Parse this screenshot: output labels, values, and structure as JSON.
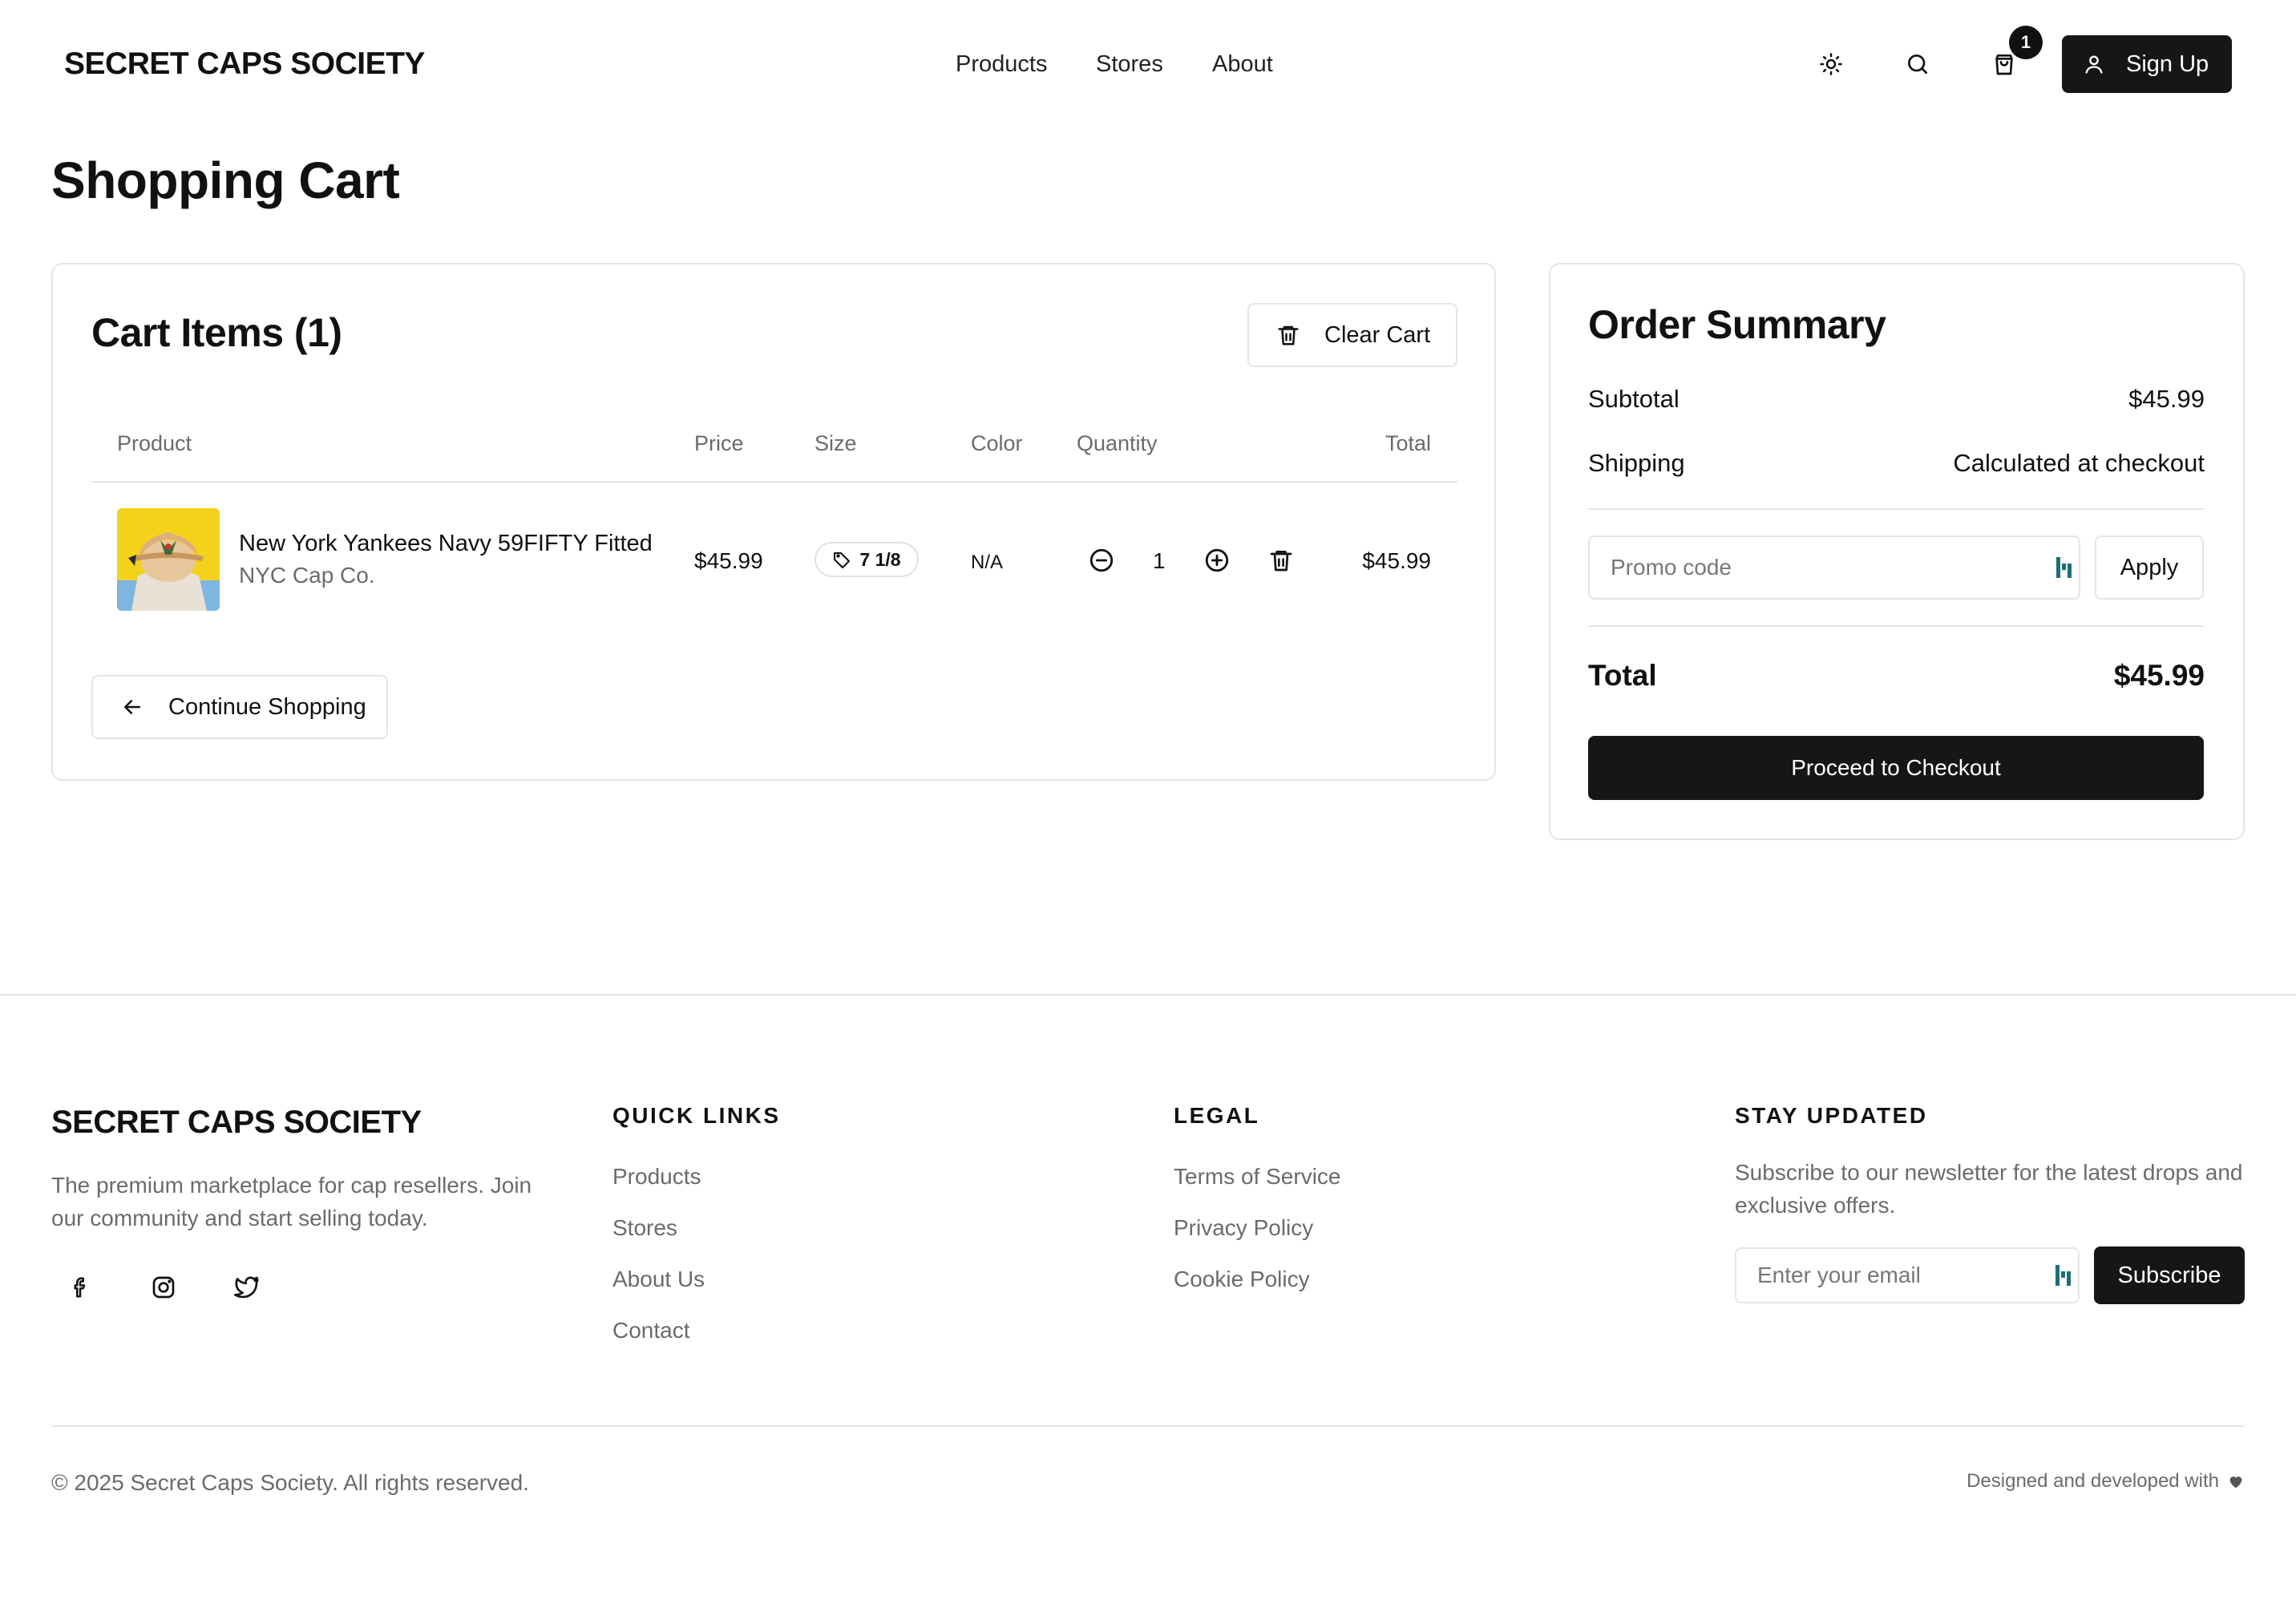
{
  "header": {
    "logo": "SECRET CAPS SOCIETY",
    "nav": [
      "Products",
      "Stores",
      "About"
    ],
    "cart_count": "1",
    "signup_label": "Sign Up"
  },
  "page_title": "Shopping Cart",
  "cart": {
    "title": "Cart Items (1)",
    "clear_label": "Clear Cart",
    "columns": {
      "product": "Product",
      "price": "Price",
      "size": "Size",
      "color": "Color",
      "quantity": "Quantity",
      "total": "Total"
    },
    "items": [
      {
        "name": "New York Yankees Navy 59FIFTY Fitted",
        "brand": "NYC Cap Co.",
        "price": "$45.99",
        "size": "7 1/8",
        "color": "N/A",
        "quantity": "1",
        "total": "$45.99"
      }
    ],
    "continue_label": "Continue Shopping"
  },
  "summary": {
    "title": "Order Summary",
    "subtotal_label": "Subtotal",
    "subtotal_value": "$45.99",
    "shipping_label": "Shipping",
    "shipping_value": "Calculated at checkout",
    "promo_placeholder": "Promo code",
    "apply_label": "Apply",
    "total_label": "Total",
    "total_value": "$45.99",
    "checkout_label": "Proceed to Checkout"
  },
  "footer": {
    "logo": "SECRET CAPS SOCIETY",
    "description": "The premium marketplace for cap resellers. Join our community and start selling today.",
    "quick_links_heading": "QUICK LINKS",
    "quick_links": [
      "Products",
      "Stores",
      "About Us",
      "Contact"
    ],
    "legal_heading": "LEGAL",
    "legal_links": [
      "Terms of Service",
      "Privacy Policy",
      "Cookie Policy"
    ],
    "newsletter_heading": "STAY UPDATED",
    "newsletter_text": "Subscribe to our newsletter for the latest drops and exclusive offers.",
    "email_placeholder": "Enter your email",
    "subscribe_label": "Subscribe",
    "copyright": "© 2025 Secret Caps Society. All rights reserved.",
    "designed_text": "Designed and developed with"
  },
  "colors": {
    "primary_button": "#161616",
    "border": "#e5e5e5",
    "muted_text": "#6b6b6b",
    "product_image_bg": "#f2d21a",
    "password_manager_icon": "#1f6f78"
  }
}
